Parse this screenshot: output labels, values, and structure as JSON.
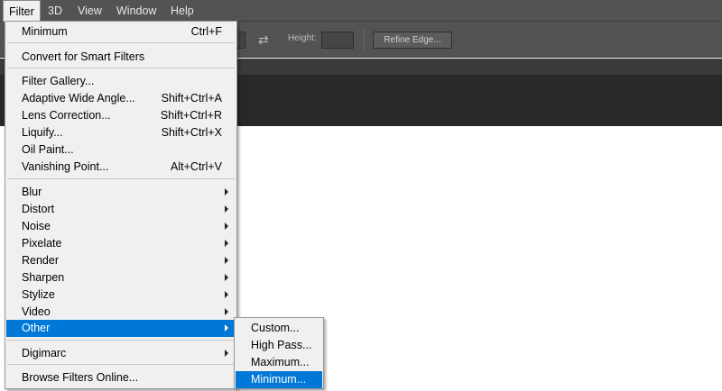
{
  "menubar": {
    "items": [
      {
        "label": "Filter",
        "active": true
      },
      {
        "label": "3D"
      },
      {
        "label": "View"
      },
      {
        "label": "Window"
      },
      {
        "label": "Help"
      }
    ]
  },
  "options_bar": {
    "height_label": "Height:",
    "refine_edge_label": "Refine Edge...",
    "swap_icon": "swap-arrows-icon"
  },
  "filter_menu": {
    "items": [
      {
        "label": "Minimum",
        "shortcut": "Ctrl+F"
      },
      {
        "label": "Convert for Smart Filters",
        "shortcut": ""
      },
      {
        "label": "Filter Gallery...",
        "shortcut": ""
      },
      {
        "label": "Adaptive Wide Angle...",
        "shortcut": "Shift+Ctrl+A"
      },
      {
        "label": "Lens Correction...",
        "shortcut": "Shift+Ctrl+R"
      },
      {
        "label": "Liquify...",
        "shortcut": "Shift+Ctrl+X"
      },
      {
        "label": "Oil Paint...",
        "shortcut": ""
      },
      {
        "label": "Vanishing Point...",
        "shortcut": "Alt+Ctrl+V"
      },
      {
        "label": "Blur",
        "submenu": true
      },
      {
        "label": "Distort",
        "submenu": true
      },
      {
        "label": "Noise",
        "submenu": true
      },
      {
        "label": "Pixelate",
        "submenu": true
      },
      {
        "label": "Render",
        "submenu": true
      },
      {
        "label": "Sharpen",
        "submenu": true
      },
      {
        "label": "Stylize",
        "submenu": true
      },
      {
        "label": "Video",
        "submenu": true
      },
      {
        "label": "Other",
        "submenu": true,
        "highlighted": true
      },
      {
        "label": "Digimarc",
        "submenu": true
      },
      {
        "label": "Browse Filters Online...",
        "shortcut": ""
      }
    ]
  },
  "other_submenu": {
    "items": [
      {
        "label": "Custom..."
      },
      {
        "label": "High Pass..."
      },
      {
        "label": "Maximum..."
      },
      {
        "label": "Minimum...",
        "highlighted": true
      }
    ]
  },
  "colors": {
    "highlight": "#0078d7",
    "menu_bg": "#f0f0f0",
    "chrome": "#535353",
    "dark_band": "#282828"
  }
}
